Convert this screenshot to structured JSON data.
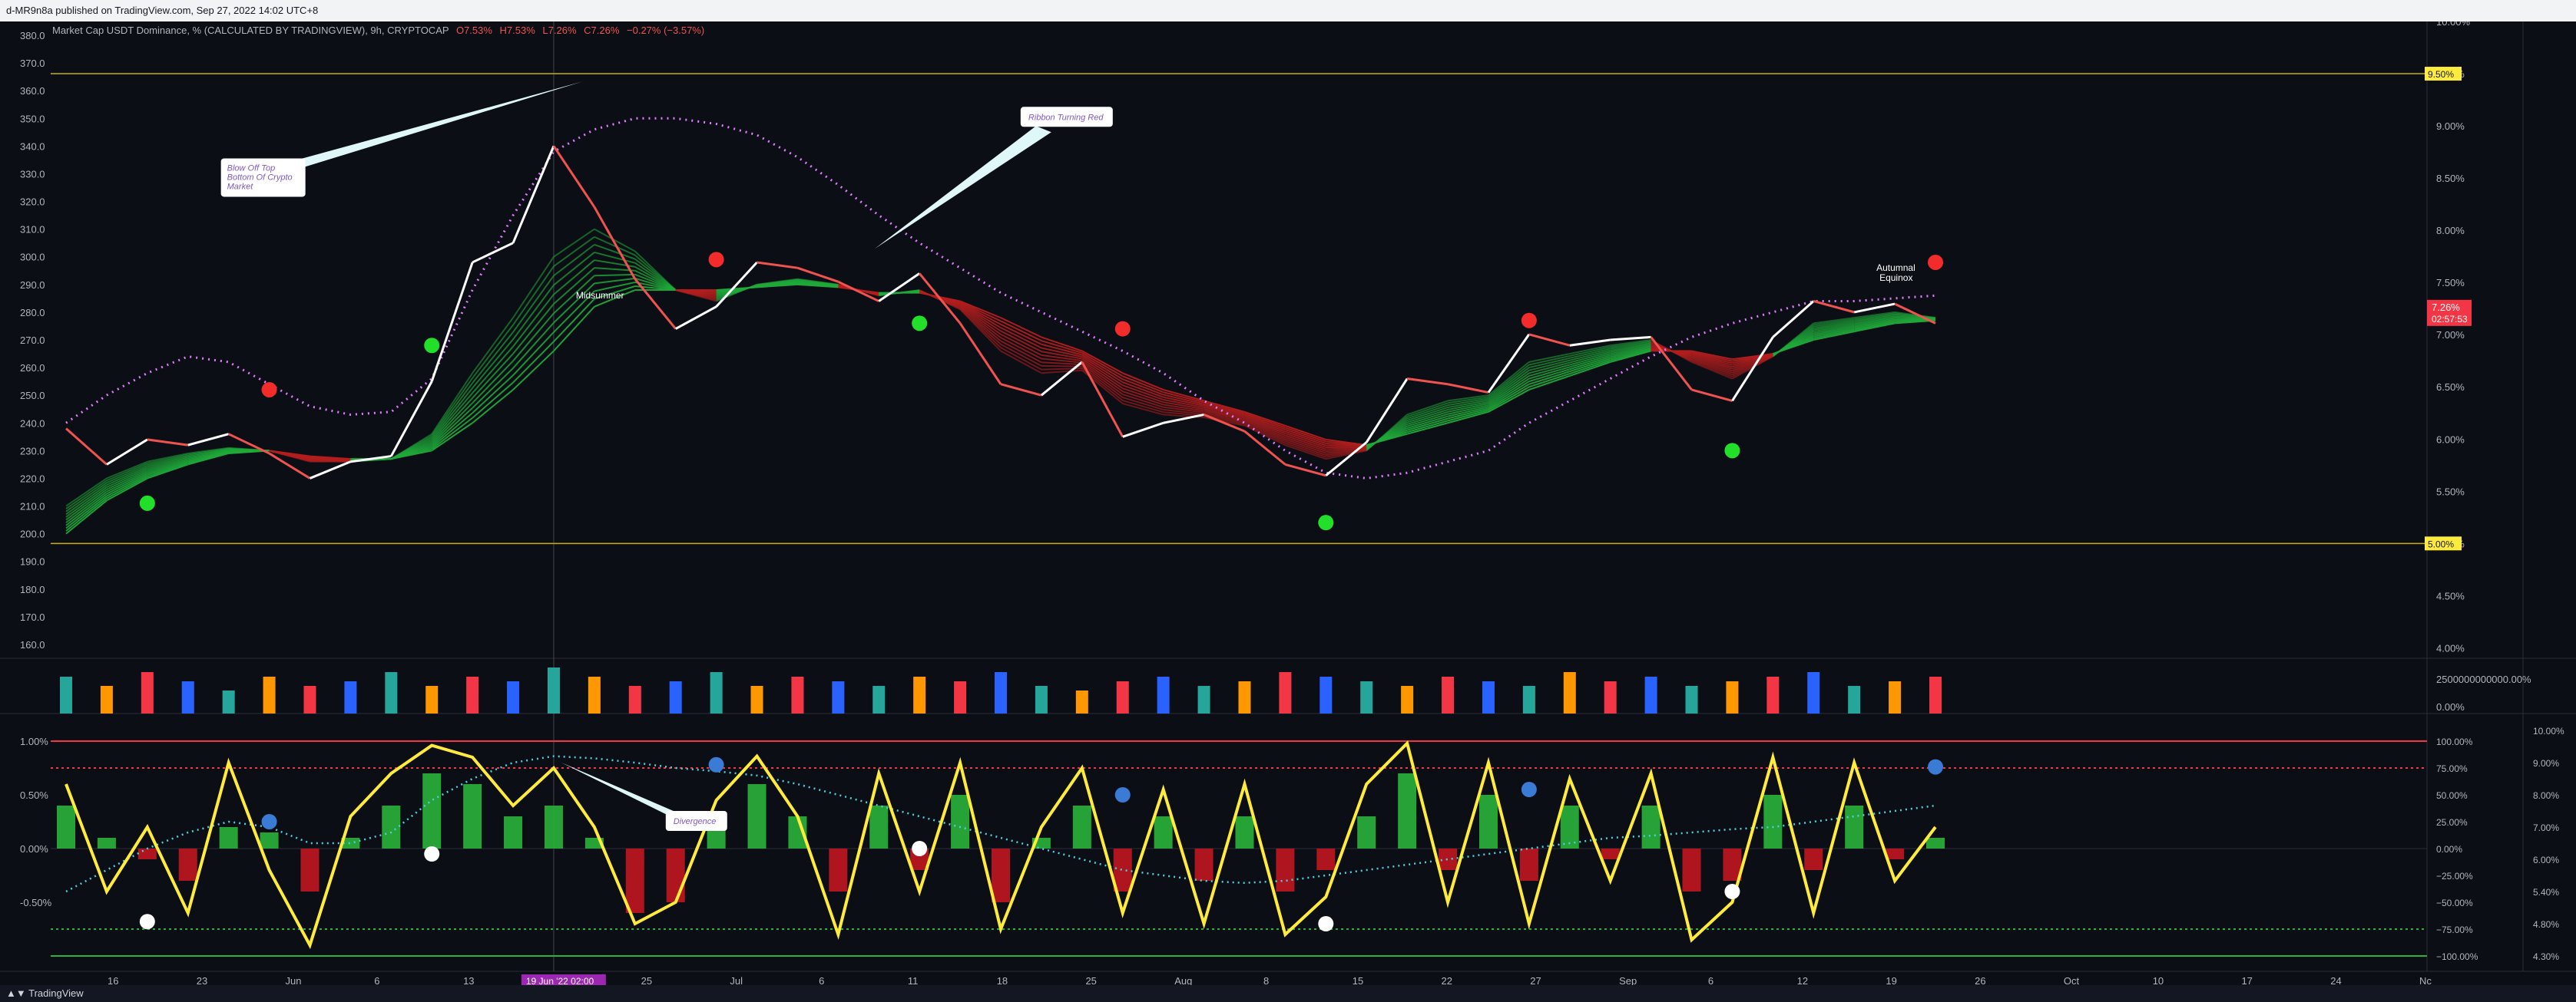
{
  "header": {
    "publisher_text": "d-MR9n8a published on TradingView.com, Sep 27, 2022 14:02 UTC+8",
    "symbol_text": "Market Cap USDT Dominance, % (CALCULATED BY TRADINGVIEW), 9h, CRYPTOCAP",
    "ohlc": {
      "open": "O7.53%",
      "high": "H7.53%",
      "low": "L7.26%",
      "close": "C7.26%",
      "change": "−0.27% (−3.57%)"
    }
  },
  "footer": {
    "brand": "TradingView"
  },
  "colors": {
    "up": "#26a69a",
    "down": "#ef5350",
    "price": "#ffffff",
    "ribbon_green": "#1faa3a",
    "ribbon_red": "#b51e1e",
    "sma_dots": "#e27bff",
    "osc_line": "#ffeb3b",
    "osc_signal": "#4dd0e1",
    "marker_green": "#22e02a",
    "marker_red": "#f22b2b",
    "marker_blue": "#3a7bd5",
    "marker_white": "#ffffff"
  },
  "chart_data": [
    {
      "type": "line",
      "title": "",
      "x_tick_labels": [
        "16",
        "23",
        "Jun",
        "6",
        "13",
        "19 Jun '22  02:00",
        "25",
        "Jul",
        "6",
        "11",
        "18",
        "25",
        "Aug",
        "8",
        "15",
        "22",
        "27",
        "Sep",
        "6",
        "12",
        "19",
        "26",
        "Oct",
        "10",
        "17",
        "24",
        "Nc"
      ],
      "left_axis_ticks": [
        "380.0",
        "370.0",
        "360.0",
        "350.0",
        "340.0",
        "330.0",
        "320.0",
        "310.0",
        "300.0",
        "290.0",
        "280.0",
        "270.0",
        "260.0",
        "250.0",
        "240.0",
        "230.0",
        "220.0",
        "210.0",
        "200.0",
        "190.0",
        "180.0",
        "170.0",
        "160.0"
      ],
      "right_axis_ticks": [
        "10.00%",
        "9.50%",
        "9.00%",
        "8.50%",
        "8.00%",
        "7.50%",
        "7.26%",
        "7.00%",
        "6.50%",
        "6.00%",
        "5.50%",
        "5.00%",
        "4.50%",
        "4.00%"
      ],
      "ylim_left": [
        155,
        385
      ],
      "ylim_right": [
        3.9,
        10.0
      ],
      "x_dates": [
        "May 12",
        "May 16",
        "May 20",
        "May 24",
        "May 28",
        "Jun 1",
        "Jun 4",
        "Jun 8",
        "Jun 12",
        "Jun 14",
        "Jun 16",
        "Jun 18",
        "Jun 19",
        "Jun 21",
        "Jun 23",
        "Jun 26",
        "Jun 29",
        "Jul 2",
        "Jul 5",
        "Jul 8",
        "Jul 11",
        "Jul 14",
        "Jul 17",
        "Jul 20",
        "Jul 23",
        "Jul 26",
        "Jul 29",
        "Aug 1",
        "Aug 4",
        "Aug 7",
        "Aug 10",
        "Aug 13",
        "Aug 16",
        "Aug 19",
        "Aug 22",
        "Aug 25",
        "Aug 28",
        "Aug 31",
        "Sep 3",
        "Sep 6",
        "Sep 9",
        "Sep 12",
        "Sep 15",
        "Sep 18",
        "Sep 21",
        "Sep 24",
        "Sep 27"
      ],
      "price_values": [
        238,
        225,
        234,
        232,
        236,
        229,
        220,
        226,
        228,
        255,
        298,
        305,
        340,
        318,
        292,
        274,
        282,
        298,
        296,
        291,
        284,
        294,
        276,
        254,
        250,
        262,
        235,
        240,
        243,
        237,
        225,
        221,
        233,
        256,
        254,
        251,
        272,
        268,
        270,
        271,
        252,
        248,
        271,
        284,
        280,
        283,
        276
      ],
      "fast_ma": [
        210,
        220,
        226,
        229,
        231,
        230,
        226,
        226,
        227,
        236,
        258,
        278,
        300,
        310,
        302,
        288,
        284,
        290,
        292,
        290,
        286,
        288,
        281,
        266,
        258,
        259,
        247,
        243,
        242,
        239,
        232,
        227,
        230,
        243,
        248,
        250,
        262,
        265,
        268,
        270,
        262,
        256,
        264,
        276,
        278,
        280,
        278
      ],
      "slow_ma": [
        200,
        212,
        220,
        225,
        229,
        230,
        228,
        227,
        227,
        230,
        240,
        252,
        266,
        282,
        288,
        288,
        288,
        289,
        290,
        289,
        287,
        287,
        284,
        278,
        271,
        266,
        258,
        252,
        248,
        244,
        239,
        234,
        232,
        236,
        240,
        244,
        252,
        257,
        262,
        266,
        266,
        263,
        265,
        270,
        273,
        276,
        277
      ],
      "sma_dots": [
        240,
        250,
        258,
        264,
        262,
        254,
        246,
        243,
        244,
        256,
        288,
        315,
        338,
        346,
        350,
        350,
        348,
        344,
        336,
        326,
        315,
        305,
        296,
        287,
        280,
        273,
        266,
        258,
        248,
        240,
        230,
        222,
        220,
        222,
        226,
        230,
        240,
        248,
        256,
        264,
        271,
        276,
        280,
        284,
        284,
        285,
        286
      ],
      "signals": [
        {
          "x": "May 20",
          "y": 211,
          "color": "green"
        },
        {
          "x": "Jun 1",
          "y": 252,
          "color": "red"
        },
        {
          "x": "Jun 14",
          "y": 268,
          "color": "green"
        },
        {
          "x": "Jun 29",
          "y": 299,
          "color": "red"
        },
        {
          "x": "Jul 14",
          "y": 276,
          "color": "green"
        },
        {
          "x": "Jul 29",
          "y": 274,
          "color": "red"
        },
        {
          "x": "Aug 13",
          "y": 204,
          "color": "green"
        },
        {
          "x": "Aug 28",
          "y": 277,
          "color": "red"
        },
        {
          "x": "Sep 12",
          "y": 230,
          "color": "green"
        },
        {
          "x": "Sep 27",
          "y": 298,
          "color": "red"
        }
      ],
      "horizontal_levels": [
        {
          "value": 9.5,
          "label": "9.50%"
        },
        {
          "value": 5.0,
          "label": "5.00%"
        }
      ],
      "last_price_label": {
        "value": 7.26,
        "label": "7.26%",
        "countdown": "02:57:53"
      },
      "annotations": [
        {
          "text": "Blow Off Top",
          "text2": "Bottom Of Crypto",
          "text3": "Market",
          "x": "May 28",
          "y": 330
        },
        {
          "text": "Ribbon Turning Red",
          "x": "Jul 26",
          "y": 350
        },
        {
          "text": "Midsummer",
          "x": "Jun 21",
          "y": 285
        },
        {
          "text": "Autumnal",
          "text2": "Equinox",
          "x": "Sep 24",
          "y": 295
        }
      ]
    },
    {
      "type": "bar",
      "title": "",
      "right_axis_ticks": [
        "2500000000000.00%",
        "0.00%"
      ],
      "volume_values": [
        8,
        6,
        9,
        7,
        5,
        8,
        6,
        7,
        9,
        6,
        8,
        7,
        10,
        8,
        6,
        7,
        9,
        6,
        8,
        7,
        6,
        8,
        7,
        9,
        6,
        5,
        7,
        8,
        6,
        7,
        9,
        8,
        7,
        6,
        8,
        7,
        6,
        9,
        7,
        8,
        6,
        7,
        8,
        9,
        6,
        7,
        8
      ]
    },
    {
      "type": "line",
      "title": "",
      "left_axis_ticks": [
        "1.00%",
        "0.50%",
        "0.00%",
        "-0.50%"
      ],
      "right_axis_ticks_a": [
        "100.00%",
        "75.00%",
        "50.00%",
        "25.00%",
        "0.00%",
        "−25.00%",
        "−50.00%",
        "−75.00%",
        "−100.00%"
      ],
      "right_axis_ticks_b": [
        "10.00%",
        "9.00%",
        "8.00%",
        "7.00%",
        "6.00%",
        "5.40%",
        "4.80%",
        "4.30%"
      ],
      "ylim": [
        -100,
        110
      ],
      "oscillator": [
        60,
        -40,
        20,
        -60,
        80,
        -20,
        -90,
        30,
        70,
        96,
        85,
        40,
        75,
        20,
        -70,
        -50,
        45,
        86,
        30,
        -80,
        70,
        -40,
        80,
        -75,
        20,
        75,
        -60,
        55,
        -70,
        60,
        -80,
        -45,
        60,
        98,
        -50,
        80,
        -70,
        65,
        -30,
        70,
        -85,
        -50,
        85,
        -60,
        80,
        -30,
        20
      ],
      "histogram": [
        40,
        10,
        -10,
        -30,
        20,
        15,
        -40,
        10,
        40,
        70,
        60,
        30,
        40,
        10,
        -60,
        -50,
        20,
        60,
        30,
        -40,
        40,
        -20,
        50,
        -50,
        10,
        40,
        -40,
        30,
        -30,
        30,
        -40,
        -20,
        30,
        70,
        -20,
        50,
        -30,
        40,
        -10,
        40,
        -40,
        -30,
        50,
        -20,
        40,
        -10,
        10
      ],
      "signal_line": [
        -40,
        -20,
        0,
        15,
        25,
        20,
        5,
        5,
        15,
        45,
        65,
        80,
        86,
        84,
        80,
        75,
        72,
        68,
        60,
        50,
        40,
        30,
        20,
        10,
        0,
        -10,
        -20,
        -25,
        -30,
        -32,
        -30,
        -25,
        -20,
        -15,
        -10,
        -5,
        0,
        5,
        10,
        12,
        15,
        18,
        20,
        25,
        30,
        35,
        40
      ],
      "levels": [
        {
          "value": 100,
          "color": "red"
        },
        {
          "value": 75,
          "color": "red",
          "dotted": true
        },
        {
          "value": -75,
          "color": "green",
          "dotted": true
        },
        {
          "value": -100,
          "color": "green"
        }
      ],
      "divergence_annotation": {
        "text": "Divergence"
      },
      "dots": [
        {
          "x": "May 20",
          "y": -68,
          "color": "white"
        },
        {
          "x": "Jun 1",
          "y": 25,
          "color": "blue"
        },
        {
          "x": "Jun 14",
          "y": -5,
          "color": "white"
        },
        {
          "x": "Jun 29",
          "y": 78,
          "color": "blue"
        },
        {
          "x": "Jul 14",
          "y": 0,
          "color": "white"
        },
        {
          "x": "Jul 29",
          "y": 50,
          "color": "blue"
        },
        {
          "x": "Aug 13",
          "y": -70,
          "color": "white"
        },
        {
          "x": "Aug 28",
          "y": 55,
          "color": "blue"
        },
        {
          "x": "Sep 12",
          "y": -40,
          "color": "white"
        },
        {
          "x": "Sep 27",
          "y": 76,
          "color": "blue"
        }
      ]
    }
  ]
}
